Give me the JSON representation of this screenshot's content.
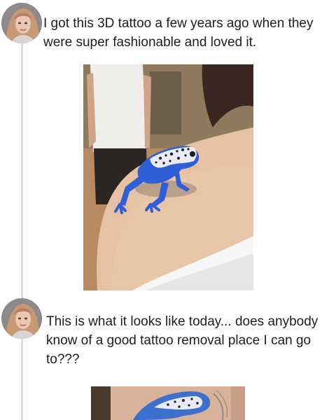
{
  "posts": [
    {
      "text": "I got this 3D tattoo a few years ago when they were super fashionable and loved it.",
      "avatar_icon": "user-avatar",
      "image_icon": "blue-frog-tattoo-photo"
    },
    {
      "text": "This is what it looks like today... does anybody know of a good tattoo removal place I can go to???",
      "avatar_icon": "user-avatar",
      "image_icon": "faded-frog-tattoo-photo"
    }
  ],
  "colors": {
    "text": "#1c1e21",
    "thread_line": "#d9dce2",
    "tattoo_blue": "#2e5fd6"
  }
}
